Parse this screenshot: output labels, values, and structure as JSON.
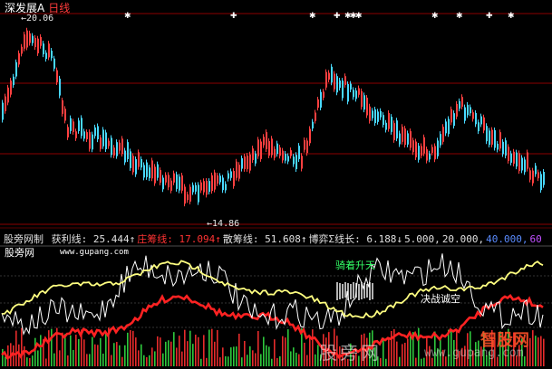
{
  "header": {
    "title": "深发展A",
    "period": "日线"
  },
  "price_panel": {
    "high_label": "20.06",
    "low_label": "14.86",
    "signal_marks": [
      {
        "date_index": 46,
        "glyph": "✱"
      },
      {
        "date_index": 85,
        "glyph": "✚"
      },
      {
        "date_index": 114,
        "glyph": "✱"
      },
      {
        "date_index": 123,
        "glyph": "✚"
      },
      {
        "date_index": 127,
        "glyph": "✱"
      },
      {
        "date_index": 129,
        "glyph": "✱"
      },
      {
        "date_index": 131,
        "glyph": "✱"
      },
      {
        "date_index": 159,
        "glyph": "✱"
      },
      {
        "date_index": 168,
        "glyph": "✱"
      },
      {
        "date_index": 179,
        "glyph": "✚"
      },
      {
        "date_index": 187,
        "glyph": "✱"
      }
    ],
    "colors": {
      "up": "#ff4040",
      "down": "#48d8ff",
      "grid": "#8b0000"
    }
  },
  "indicator": {
    "name": "股旁网制",
    "items": [
      {
        "label": "获利线:",
        "value": "25.444",
        "arrow": "↑",
        "color": "#e0e0e0"
      },
      {
        "label": "庄筹线:",
        "value": "17.094",
        "arrow": "↑",
        "color": "#ff3333"
      },
      {
        "label": "散筹线:",
        "value": "51.608",
        "arrow": "↑",
        "color": "#e0e0e0"
      },
      {
        "label": "博弈Σ线长:",
        "value": "6.188",
        "arrow": "↓",
        "color": "#e0e0e0"
      },
      {
        "label": "",
        "value": "5.000,",
        "arrow": "",
        "color": "#e0e0e0"
      },
      {
        "label": "",
        "value": "20.000,",
        "arrow": "",
        "color": "#e0e0e0"
      },
      {
        "label": "",
        "value": "40.000,",
        "arrow": "",
        "color": "#5b8cff"
      },
      {
        "label": "",
        "value": "60",
        "arrow": "",
        "color": "#c050ff"
      }
    ],
    "site_name": "股旁网",
    "site_url": "www.gupang.com",
    "annotations": {
      "top": "骑着升天",
      "bottom": "决战诚空"
    },
    "series_colors": {
      "profit": "#ffffff",
      "main": "#ff2222",
      "retail": "#ffff80"
    }
  },
  "watermarks": {
    "left": "股旁网",
    "url": "www.gupang.com",
    "logo": "智股网"
  }
}
